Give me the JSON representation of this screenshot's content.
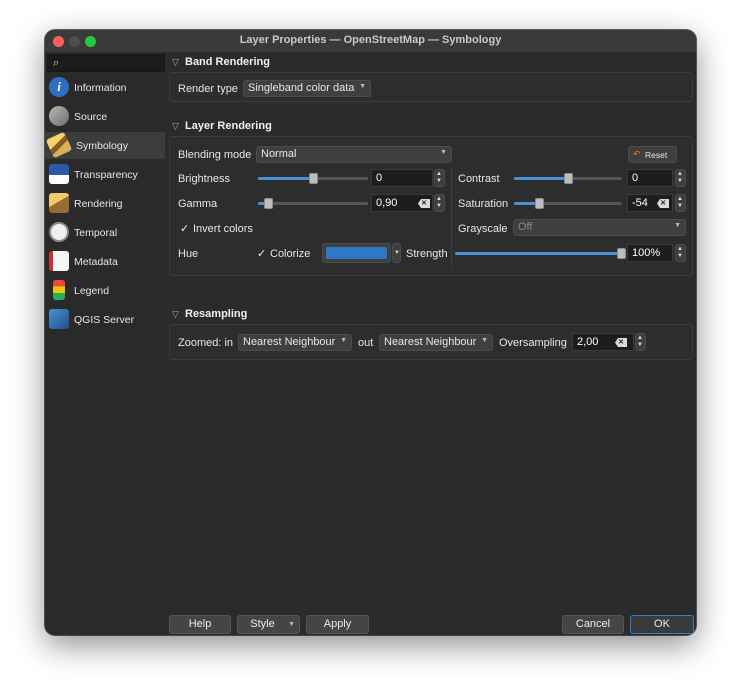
{
  "window": {
    "title": "Layer Properties — OpenStreetMap — Symbology"
  },
  "search": {
    "glyph": "⌕",
    "placeholder": ""
  },
  "sidebar": {
    "items": [
      {
        "label": "Information",
        "icon": "information-icon"
      },
      {
        "label": "Source",
        "icon": "source-icon"
      },
      {
        "label": "Symbology",
        "icon": "symbology-icon",
        "active": true
      },
      {
        "label": "Transparency",
        "icon": "transparency-icon"
      },
      {
        "label": "Rendering",
        "icon": "rendering-icon"
      },
      {
        "label": "Temporal",
        "icon": "temporal-icon"
      },
      {
        "label": "Metadata",
        "icon": "metadata-icon"
      },
      {
        "label": "Legend",
        "icon": "legend-icon"
      },
      {
        "label": "QGIS Server",
        "icon": "qgis-server-icon"
      }
    ],
    "info_glyph": "i"
  },
  "sections": {
    "band": {
      "title": "Band Rendering",
      "arrow": "▽",
      "render_type_label": "Render type",
      "render_type_value": "Singleband color data"
    },
    "layer": {
      "title": "Layer Rendering",
      "arrow": "▽",
      "blending_mode_label": "Blending mode",
      "blending_mode_value": "Normal",
      "reset_label": "Reset",
      "reset_glyph": "↶",
      "brightness_label": "Brightness",
      "brightness_value": "0",
      "brightness_level": 0.5,
      "contrast_label": "Contrast",
      "contrast_value": "0",
      "contrast_level": 0.5,
      "gamma_label": "Gamma",
      "gamma_value": "0,90",
      "gamma_level": 0.09,
      "saturation_label": "Saturation",
      "saturation_value": "-54",
      "saturation_level": 0.23,
      "invert_colors_label": "Invert colors",
      "invert_colors_checked": true,
      "grayscale_label": "Grayscale",
      "grayscale_value": "Off",
      "hue_label": "Hue",
      "colorize_label": "Colorize",
      "colorize_checked": true,
      "colorize_color": "#2e79c3",
      "strength_label": "Strength",
      "strength_value": "100%",
      "strength_level": 1.0
    },
    "resampling": {
      "title": "Resampling",
      "arrow": "▽",
      "zoomed_in_label": "Zoomed: in",
      "zoomed_in_value": "Nearest Neighbour",
      "zoomed_out_label": "out",
      "zoomed_out_value": "Nearest Neighbour",
      "oversampling_label": "Oversampling",
      "oversampling_value": "2,00"
    }
  },
  "glyphs": {
    "check": "✓",
    "combo_arrow": "▼",
    "step_up": "▲",
    "step_down": "▼",
    "clear": "✕"
  },
  "footer": {
    "help": "Help",
    "style": "Style",
    "apply": "Apply",
    "cancel": "Cancel",
    "ok": "OK"
  },
  "colors": {
    "accent": "#4a90d9",
    "traffic_close": "#ff5f57",
    "traffic_max": "#28c840",
    "reset_icon": "#e0782a"
  }
}
